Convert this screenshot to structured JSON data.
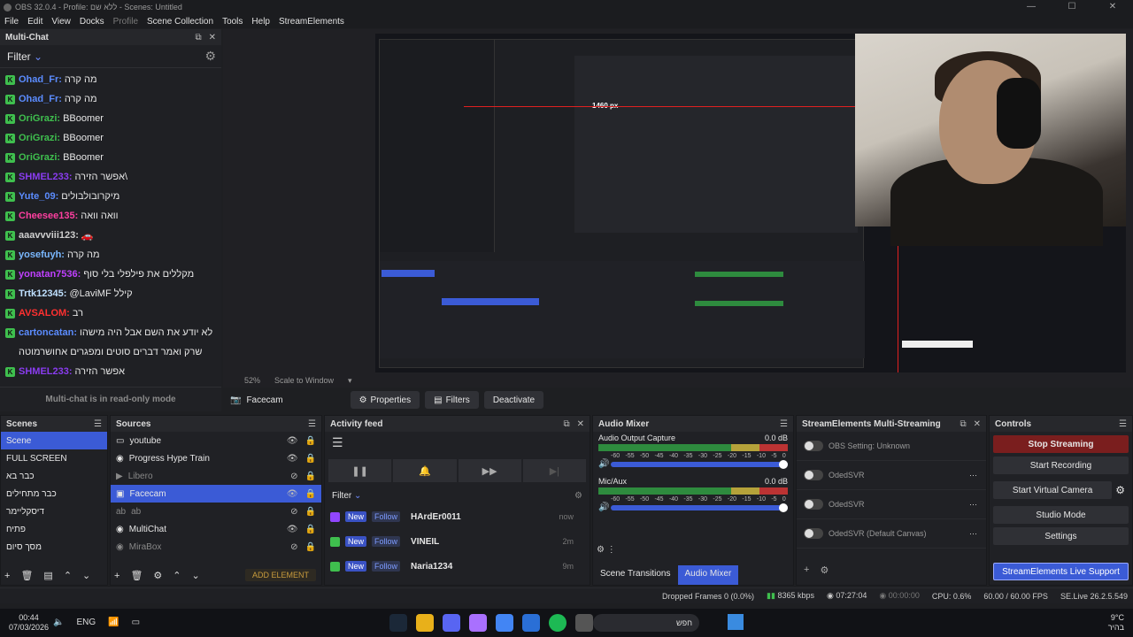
{
  "window": {
    "title": "OBS 32.0.4 - Profile: ללא שם - Scenes: Untitled"
  },
  "menu": [
    "File",
    "Edit",
    "View",
    "Docks",
    "Profile",
    "Scene Collection",
    "Tools",
    "Help",
    "StreamElements"
  ],
  "multichat": {
    "title": "Multi-Chat",
    "filter_label": "Filter",
    "footer": "Multi-chat is in read-only mode",
    "messages": [
      {
        "user": "Ohad_Fr:",
        "text": "מה קרה",
        "color": "#5b8cff"
      },
      {
        "user": "Ohad_Fr:",
        "text": "מה קרה",
        "color": "#5b8cff"
      },
      {
        "user": "OriGrazi:",
        "text": "BBoomer",
        "color": "#3fbf4e"
      },
      {
        "user": "OriGrazi:",
        "text": "BBoomer",
        "color": "#3fbf4e"
      },
      {
        "user": "OriGrazi:",
        "text": "BBoomer",
        "color": "#3fbf4e"
      },
      {
        "user": "SHMEL233:",
        "text": "אפשר הזירה\\",
        "color": "#8a3cf0"
      },
      {
        "user": "Yute_09:",
        "text": "מיקרובולבולים",
        "color": "#5b8cff"
      },
      {
        "user": "Cheesee135:",
        "text": "וואה וואה",
        "color": "#ff3fa0"
      },
      {
        "user": "aaavvviii123:",
        "text": "🚗",
        "color": "#cfcfcf"
      },
      {
        "user": "yosefuyh:",
        "text": "מה קרה",
        "color": "#7ab8ff"
      },
      {
        "user": "yonatan7536:",
        "text": "מקללים את פילפלי בלי סוף",
        "color": "#c040ff"
      },
      {
        "user": "Trtk12345:",
        "text": "@LaviMF קילל",
        "color": "#bfe0ff"
      },
      {
        "user": "AVSALOM:",
        "text": "רב",
        "color": "#ff3030"
      },
      {
        "user": "cartoncatan:",
        "text": "לא יודע את השם אבל היה מישהו",
        "color": "#5b8cff"
      },
      {
        "user": "",
        "text": "שרק ואמר דברים סוטים ומפגרים אחושרמוטה",
        "color": "#cfcfcf"
      },
      {
        "user": "SHMEL233:",
        "text": "אפשר הזירה",
        "color": "#8a3cf0"
      }
    ]
  },
  "preview": {
    "zoom": "52%",
    "scale_mode": "Scale to Window",
    "measure": "1460 px"
  },
  "source_bar": {
    "source": "Facecam",
    "properties": "Properties",
    "filters": "Filters",
    "deactivate": "Deactivate"
  },
  "scenes": {
    "title": "Scenes",
    "items": [
      "Scene",
      "FULL SCREEN",
      "כבר בא",
      "כבר מתחילים",
      "דיסקליימר",
      "פתיח",
      "מסך סיום"
    ],
    "selected": 0
  },
  "sources": {
    "title": "Sources",
    "add_element": "ADD ELEMENT",
    "items": [
      {
        "name": "youtube",
        "icon": "▭",
        "visible": true,
        "state": "visible"
      },
      {
        "name": "Progress Hype Train",
        "icon": "◉",
        "visible": true,
        "state": "visible"
      },
      {
        "name": "Libero",
        "icon": "▶",
        "visible": false,
        "state": "hidden"
      },
      {
        "name": "Facecam",
        "icon": "▣",
        "visible": true,
        "state": "selected"
      },
      {
        "name": "ab",
        "icon": "ab",
        "visible": false,
        "state": "hidden"
      },
      {
        "name": "MultiChat",
        "icon": "◉",
        "visible": true,
        "state": "visible"
      },
      {
        "name": "MiraBox",
        "icon": "◉",
        "visible": false,
        "state": "hidden"
      }
    ]
  },
  "activity": {
    "title": "Activity feed",
    "filter": "Filter",
    "rows": [
      {
        "platform": "twitch",
        "user": "HArdEr0011",
        "time": "now"
      },
      {
        "platform": "kick",
        "user": "VINEIL",
        "time": "2m"
      },
      {
        "platform": "kick",
        "user": "Naria1234",
        "time": "9m"
      }
    ],
    "new_label": "New",
    "follow_label": "Follow"
  },
  "mixer": {
    "title": "Audio Mixer",
    "channels": [
      {
        "name": "Audio Output Capture",
        "db": "0.0 dB"
      },
      {
        "name": "Mic/Aux",
        "db": "0.0 dB"
      }
    ],
    "scale": [
      "-60",
      "-55",
      "-50",
      "-45",
      "-40",
      "-35",
      "-30",
      "-25",
      "-20",
      "-15",
      "-10",
      "-5",
      "0"
    ],
    "tab_transitions": "Scene Transitions",
    "tab_mixer": "Audio Mixer"
  },
  "se": {
    "title": "StreamElements Multi-Streaming",
    "rows": [
      {
        "label": "OBS Setting: Unknown"
      },
      {
        "label": "OdedSVR"
      },
      {
        "label": "OdedSVR"
      },
      {
        "label": "OdedSVR (Default Canvas)"
      }
    ]
  },
  "controls": {
    "title": "Controls",
    "stop": "Stop Streaming",
    "record": "Start Recording",
    "vcam": "Start Virtual Camera",
    "studio": "Studio Mode",
    "settings": "Settings",
    "support": "StreamElements Live Support"
  },
  "status": {
    "dropped": "Dropped Frames 0 (0.0%)",
    "kbps": "8365 kbps",
    "live_time": "07:27:04",
    "rec_time": "00:00:00",
    "cpu": "CPU: 0.6%",
    "fps": "60.00 / 60.00 FPS",
    "version": "SE.Live 26.2.5.549"
  },
  "taskbar": {
    "time": "00:44",
    "date": "07/03/2026",
    "lang": "ENG",
    "search": "חפש",
    "weather": "9°C",
    "weather_sub": "בהיר"
  },
  "colors": {
    "accent": "#3b5bd6",
    "live": "#7a1e1e",
    "kick": "#3fbf4e",
    "twitch": "#9146ff"
  }
}
